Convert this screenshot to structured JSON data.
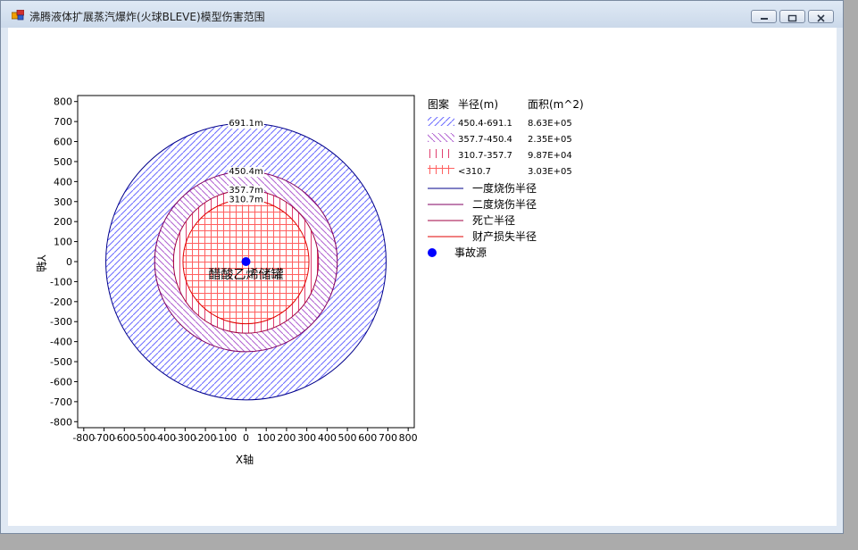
{
  "window": {
    "title": "沸腾液体扩展蒸汽爆炸(火球BLEVE)模型伤害范围",
    "controls": [
      "minimize-icon",
      "restore-icon",
      "close-icon"
    ]
  },
  "chart_data": {
    "type": "concentric-zones",
    "xlabel": "X轴",
    "ylabel": "Y轴",
    "xlim": [
      -830,
      830
    ],
    "ylim": [
      -830,
      830
    ],
    "xticks": [
      -800,
      -700,
      -600,
      -500,
      -400,
      -300,
      -200,
      -100,
      0,
      100,
      200,
      300,
      400,
      500,
      600,
      700,
      800
    ],
    "yticks": [
      800,
      700,
      600,
      500,
      400,
      300,
      200,
      100,
      0,
      -100,
      -200,
      -300,
      -400,
      -500,
      -600,
      -700,
      -800
    ],
    "source": {
      "x": 0,
      "y": 0,
      "label": "醋酸乙烯储罐",
      "color": "#0000ff"
    },
    "circles": [
      {
        "radius": 691.1,
        "label": "691.1m",
        "color": "#00008b",
        "fill": "#6a6aff",
        "pattern": "diag-fwd"
      },
      {
        "radius": 450.4,
        "label": "450.4m",
        "color": "#800060",
        "fill": "#b060d0",
        "pattern": "diag-back"
      },
      {
        "radius": 357.7,
        "label": "357.7m",
        "color": "#a00040",
        "fill": "#e04070",
        "pattern": "vertical"
      },
      {
        "radius": 310.7,
        "label": "310.7m",
        "color": "#e00000",
        "fill": "#ff6060",
        "pattern": "grid"
      }
    ],
    "legend": {
      "headers": {
        "pattern": "图案",
        "radius": "半径(m)",
        "area": "面积(m^2)"
      },
      "zones": [
        {
          "pattern": "diag-fwd",
          "radius": "450.4-691.1",
          "area": "8.63E+05"
        },
        {
          "pattern": "diag-back",
          "radius": "357.7-450.4",
          "area": "2.35E+05"
        },
        {
          "pattern": "vertical",
          "radius": "310.7-357.7",
          "area": "9.87E+04"
        },
        {
          "pattern": "grid",
          "radius": "<310.7",
          "area": "3.03E+05"
        }
      ],
      "lines": [
        {
          "label": "一度烧伤半径",
          "color": "#00008b"
        },
        {
          "label": "二度烧伤半径",
          "color": "#800060"
        },
        {
          "label": "死亡半径",
          "color": "#a00040"
        },
        {
          "label": "财产损失半径",
          "color": "#e00000"
        }
      ],
      "marker": {
        "label": "事故源",
        "color": "#0000ff"
      }
    }
  }
}
